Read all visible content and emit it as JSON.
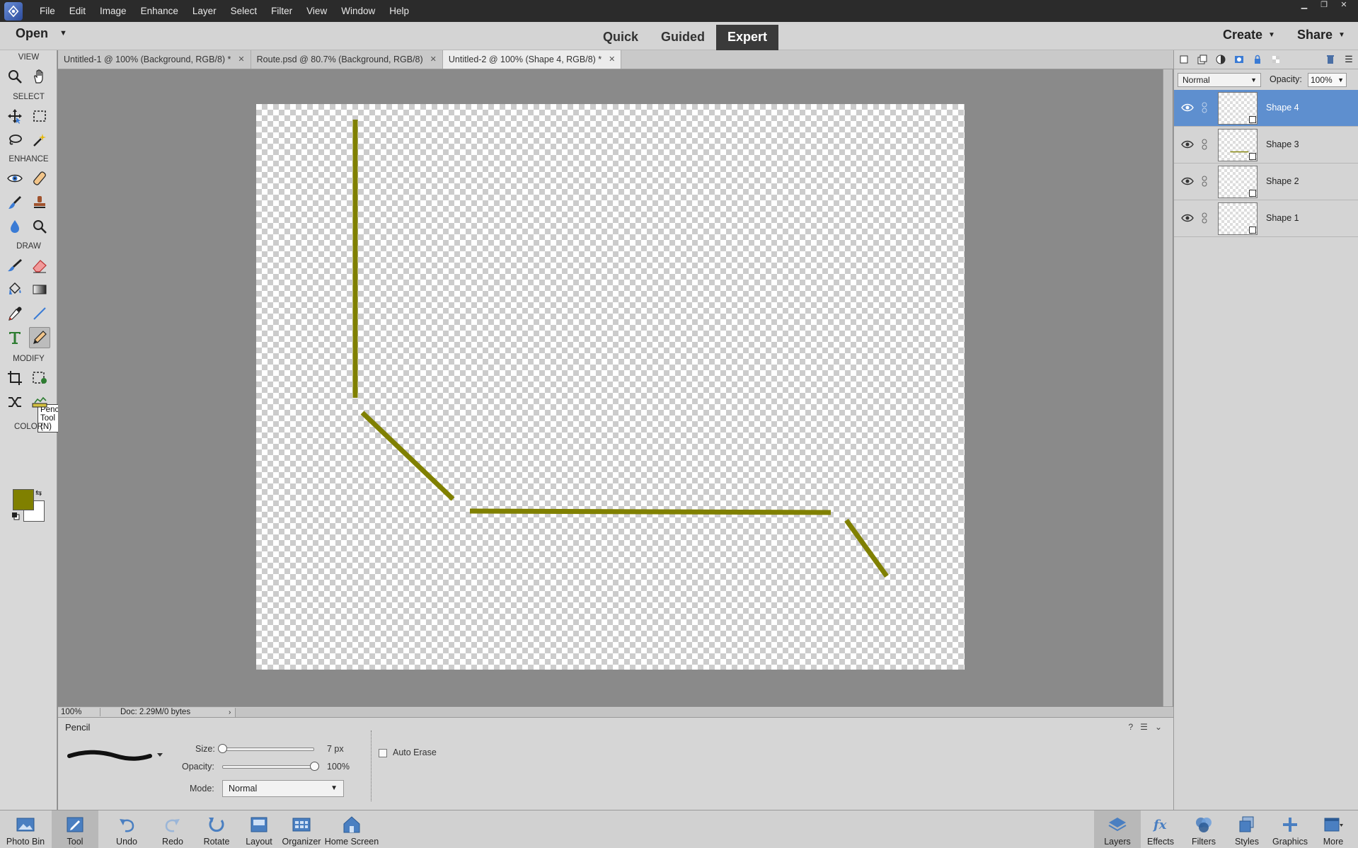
{
  "menu": [
    "File",
    "Edit",
    "Image",
    "Enhance",
    "Layer",
    "Select",
    "Filter",
    "View",
    "Window",
    "Help"
  ],
  "modebar": {
    "open_label": "Open",
    "modes": [
      "Quick",
      "Guided",
      "Expert"
    ],
    "active_mode": "Expert",
    "create_label": "Create",
    "share_label": "Share"
  },
  "toolbox": {
    "sections": [
      "VIEW",
      "SELECT",
      "ENHANCE",
      "DRAW",
      "MODIFY",
      "COLOR"
    ],
    "tooltip": "Pencil Tool (N)",
    "foreground_color": "#808000",
    "background_color": "#ffffff"
  },
  "doc_tabs": [
    {
      "label": "Untitled-1 @ 100% (Background, RGB/8) *"
    },
    {
      "label": "Route.psd @ 80.7% (Background, RGB/8)"
    },
    {
      "label": "Untitled-2 @ 100% (Shape 4, RGB/8) *",
      "active": true
    }
  ],
  "status": {
    "zoom": "100%",
    "doc": "Doc: 2.29M/0 bytes"
  },
  "tool_options": {
    "tool_name": "Pencil",
    "size_label": "Size:",
    "size_value": "7 px",
    "size_fraction": 0.0,
    "opacity_label": "Opacity:",
    "opacity_value": "100%",
    "opacity_fraction": 1.0,
    "mode_label": "Mode:",
    "mode_value": "Normal",
    "auto_erase_label": "Auto Erase",
    "auto_erase_checked": false
  },
  "canvas": {
    "stroke_color": "#808000"
  },
  "layers_panel": {
    "blend_mode": "Normal",
    "opacity_label": "Opacity:",
    "opacity_value": "100%",
    "layers": [
      {
        "name": "Shape 4",
        "selected": true
      },
      {
        "name": "Shape 3",
        "selected": false
      },
      {
        "name": "Shape 2",
        "selected": false
      },
      {
        "name": "Shape 1",
        "selected": false
      }
    ]
  },
  "bottom_left": [
    "Photo Bin",
    "Tool Options",
    "Undo",
    "Redo",
    "Rotate",
    "Layout",
    "Organizer",
    "Home Screen"
  ],
  "bottom_right": [
    "Layers",
    "Effects",
    "Filters",
    "Styles",
    "Graphics",
    "More"
  ]
}
